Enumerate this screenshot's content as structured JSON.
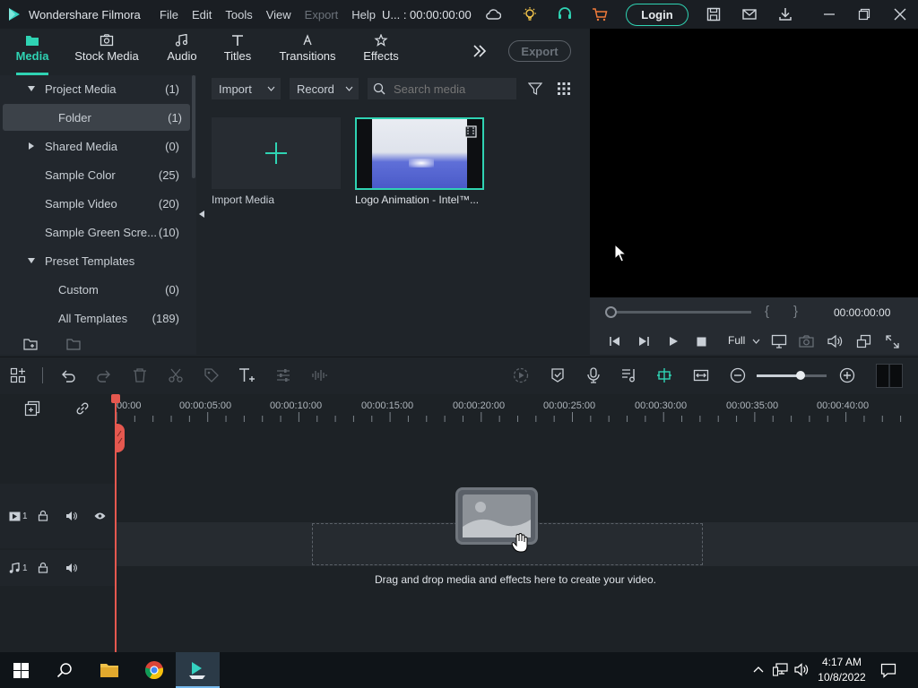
{
  "titlebar": {
    "app_name": "Wondershare Filmora",
    "menus": [
      "File",
      "Edit",
      "Tools",
      "View",
      "Export",
      "Help"
    ],
    "project_status": "U... : 00:00:00:00",
    "login": "Login"
  },
  "tabs": [
    {
      "label": "Media",
      "icon": "media-folder-icon",
      "active": true
    },
    {
      "label": "Stock Media",
      "icon": "stock-media-icon"
    },
    {
      "label": "Audio",
      "icon": "music-note-icon"
    },
    {
      "label": "Titles",
      "icon": "title-t-icon"
    },
    {
      "label": "Transitions",
      "icon": "transition-icon"
    },
    {
      "label": "Effects",
      "icon": "effects-icon"
    }
  ],
  "export_button": "Export",
  "sidebar": {
    "items": [
      {
        "label": "Project Media",
        "count": "(1)"
      },
      {
        "label": "Folder",
        "count": "(1)"
      },
      {
        "label": "Shared Media",
        "count": "(0)"
      },
      {
        "label": "Sample Color",
        "count": "(25)"
      },
      {
        "label": "Sample Video",
        "count": "(20)"
      },
      {
        "label": "Sample Green Scre...",
        "count": "(10)"
      },
      {
        "label": "Preset Templates",
        "count": ""
      },
      {
        "label": "Custom",
        "count": "(0)"
      },
      {
        "label": "All Templates",
        "count": "(189)"
      }
    ]
  },
  "media_toolbar": {
    "import": "Import",
    "record": "Record",
    "search_placeholder": "Search media"
  },
  "media_items": {
    "import_label": "Import Media",
    "clip_label": "Logo Animation - Intel™..."
  },
  "preview": {
    "timecode": "00:00:00:00",
    "quality": "Full"
  },
  "timeline": {
    "ruler": [
      "00:00",
      "00:00:05:00",
      "00:00:10:00",
      "00:00:15:00",
      "00:00:20:00",
      "00:00:25:00",
      "00:00:30:00",
      "00:00:35:00",
      "00:00:40:00"
    ],
    "drop_hint": "Drag and drop media and effects here to create your video.",
    "video_track": "1",
    "audio_track": "1",
    "zoom_fraction": 0.63
  },
  "taskbar": {
    "time": "4:17 AM",
    "date": "10/8/2022"
  },
  "colors": {
    "accent": "#2fd3b3",
    "playhead": "#e5584f"
  }
}
